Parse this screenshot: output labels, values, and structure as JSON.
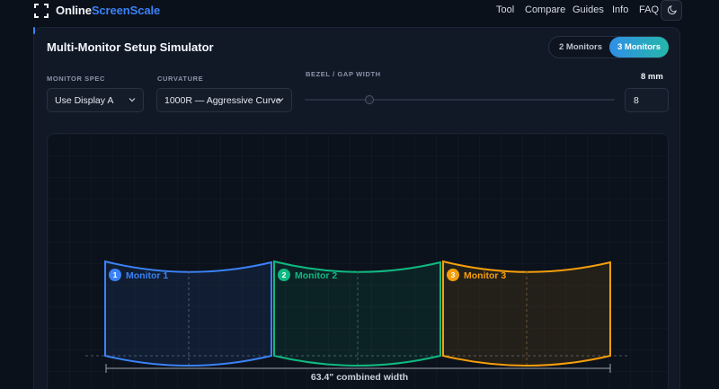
{
  "nav": {
    "brand_part1": "Online",
    "brand_part2": "ScreenScale",
    "links": [
      "Tool",
      "Compare",
      "Guides",
      "Info",
      "FAQ"
    ]
  },
  "simulator": {
    "title": "Multi-Monitor Setup Simulator",
    "toggle": {
      "option_2": "2 Monitors",
      "option_3": "3 Monitors",
      "selected": "3 Monitors"
    },
    "monitor_spec": {
      "label": "MONITOR SPEC",
      "value": "Use Display A"
    },
    "curvature": {
      "label": "CURVATURE",
      "value": "1000R — Aggressive Curve"
    },
    "bezel": {
      "label": "BEZEL / GAP WIDTH",
      "readout": "8 mm",
      "value": "8"
    },
    "monitors": [
      {
        "num": "1",
        "name": "Monitor 1",
        "color": "#3b82f6"
      },
      {
        "num": "2",
        "name": "Monitor 2",
        "color": "#10b981"
      },
      {
        "num": "3",
        "name": "Monitor 3",
        "color": "#f59e0b"
      }
    ],
    "combined_width": "63.4\" combined width"
  },
  "icons": [
    "focus-frame-icon",
    "moon-icon",
    "chevron-down-icon"
  ],
  "colors": {
    "accent": "#3b82f6",
    "gradient_end": "#25b7a9"
  }
}
